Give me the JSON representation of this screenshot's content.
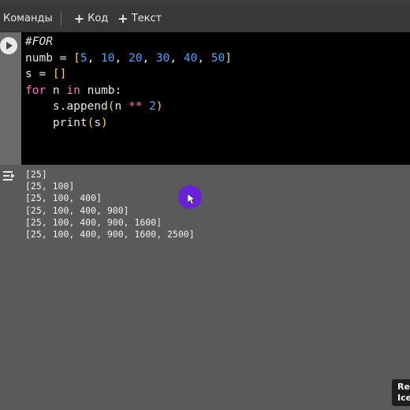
{
  "toolbar": {
    "commands_label": "Команды",
    "add_code_label": "Код",
    "add_text_label": "Текст"
  },
  "code_lines": [
    "#FOR",
    "numb = [5, 10, 20, 30, 40, 50]",
    "s = []",
    "for n in numb:",
    "    s.append(n ** 2)",
    "    print(s)"
  ],
  "output_lines": [
    "[25]",
    "[25, 100]",
    "[25, 100, 400]",
    "[25, 100, 400, 900]",
    "[25, 100, 400, 900, 1600]",
    "[25, 100, 400, 900, 1600, 2500]"
  ],
  "toast": {
    "line1": "Re",
    "line2": "Ice"
  },
  "colors": {
    "number": "#4fa3ff",
    "keyword": "#ff6ec7",
    "bracket": "#ffd24a",
    "cursor_highlight": "#6a1fe0"
  }
}
